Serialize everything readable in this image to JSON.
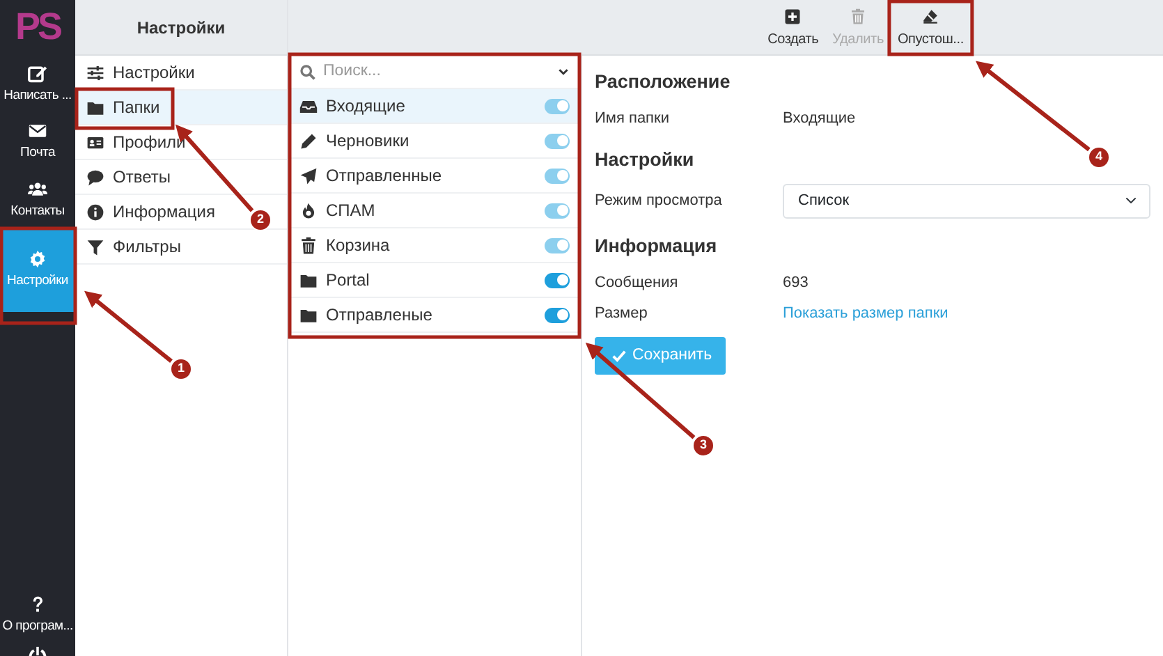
{
  "app_sidebar": {
    "logo": "PS",
    "items": [
      {
        "label": "Написать ...",
        "selected": false
      },
      {
        "label": "Почта",
        "selected": false
      },
      {
        "label": "Контакты",
        "selected": false
      },
      {
        "label": "Настройки",
        "selected": true
      }
    ],
    "bottom_items": [
      {
        "label": "О програм..."
      }
    ]
  },
  "settings_nav": {
    "title": "Настройки",
    "items": [
      {
        "label": "Настройки",
        "selected": false
      },
      {
        "label": "Папки",
        "selected": true
      },
      {
        "label": "Профили",
        "selected": false
      },
      {
        "label": "Ответы",
        "selected": false
      },
      {
        "label": "Информация",
        "selected": false
      },
      {
        "label": "Фильтры",
        "selected": false
      }
    ]
  },
  "folders": {
    "search": {
      "placeholder": "Поиск..."
    },
    "items": [
      {
        "name": "Входящие",
        "selected": true,
        "on": true,
        "disabled": true
      },
      {
        "name": "Черновики",
        "selected": false,
        "on": true,
        "disabled": true
      },
      {
        "name": "Отправленные",
        "selected": false,
        "on": true,
        "disabled": true
      },
      {
        "name": "СПАМ",
        "selected": false,
        "on": true,
        "disabled": true
      },
      {
        "name": "Корзина",
        "selected": false,
        "on": true,
        "disabled": true
      },
      {
        "name": "Portal",
        "selected": false,
        "on": true,
        "disabled": false
      },
      {
        "name": "Отправленые",
        "selected": false,
        "on": true,
        "disabled": false
      }
    ]
  },
  "toolbar": [
    {
      "label": "Создать",
      "disabled": false
    },
    {
      "label": "Удалить",
      "disabled": true
    },
    {
      "label": "Опустош...",
      "disabled": false
    }
  ],
  "details": {
    "sections": [
      {
        "title": "Расположение",
        "rows": [
          {
            "kind": "text",
            "label": "Имя папки",
            "value": "Входящие"
          }
        ]
      },
      {
        "title": "Настройки",
        "rows": [
          {
            "kind": "select",
            "label": "Режим просмотра",
            "value": "Список"
          }
        ]
      },
      {
        "title": "Информация",
        "rows": [
          {
            "kind": "text",
            "label": "Сообщения",
            "value": "693"
          },
          {
            "kind": "link",
            "label": "Размер",
            "value": "Показать размер папки"
          }
        ]
      }
    ],
    "save_button": "Сохранить"
  },
  "annotations": [
    {
      "number": "1"
    },
    {
      "number": "2"
    },
    {
      "number": "3"
    },
    {
      "number": "4"
    }
  ]
}
